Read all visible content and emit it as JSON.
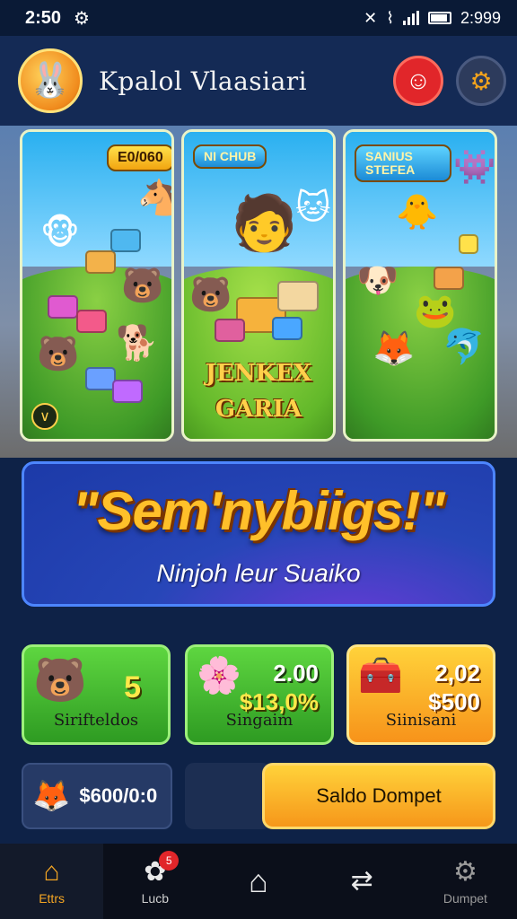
{
  "status_bar": {
    "time": "2:50",
    "right_time": "2:999"
  },
  "header": {
    "app_title": "Kpalol Vlaasiari",
    "logo_icon": "bunny-mascot-icon",
    "avatar_icon": "profile-icon",
    "settings_icon": "gear-icon"
  },
  "games": [
    {
      "badge": "E0/060",
      "title": ""
    },
    {
      "badge": "NI CHUB",
      "title_line1": "JENKEX",
      "title_line2": "GARIA"
    },
    {
      "badge": "SANIUS STEFEA",
      "title": ""
    }
  ],
  "promo": {
    "headline": "\"Sem'nybiigs!\"",
    "subtitle": "Ninjoh leur Suaiko"
  },
  "stats": [
    {
      "value": "5",
      "label": "Sirifteldos"
    },
    {
      "value_line1": "2.00",
      "value_line2": "$13,0%",
      "label": "Singaim"
    },
    {
      "value_line1": "2,02",
      "value_line2": "$500",
      "label": "Siinisani"
    }
  ],
  "balance": {
    "value": "$600/0:0"
  },
  "wallet_button": {
    "label": "Saldo Dompet"
  },
  "nav": [
    {
      "label": "Ettrs",
      "icon": "home-icon",
      "active": true
    },
    {
      "label": "Lucb",
      "icon": "gamepad-icon",
      "badge": "5"
    },
    {
      "label": "",
      "icon": "house-outline-icon"
    },
    {
      "label": "",
      "icon": "transfer-icon"
    },
    {
      "label": "Dumpet",
      "icon": "profile-gear-icon"
    }
  ],
  "colors": {
    "background": "#0e2247",
    "accent_orange": "#f5a623",
    "card_green": "#3fb82c",
    "banner_blue": "#2746b8"
  }
}
